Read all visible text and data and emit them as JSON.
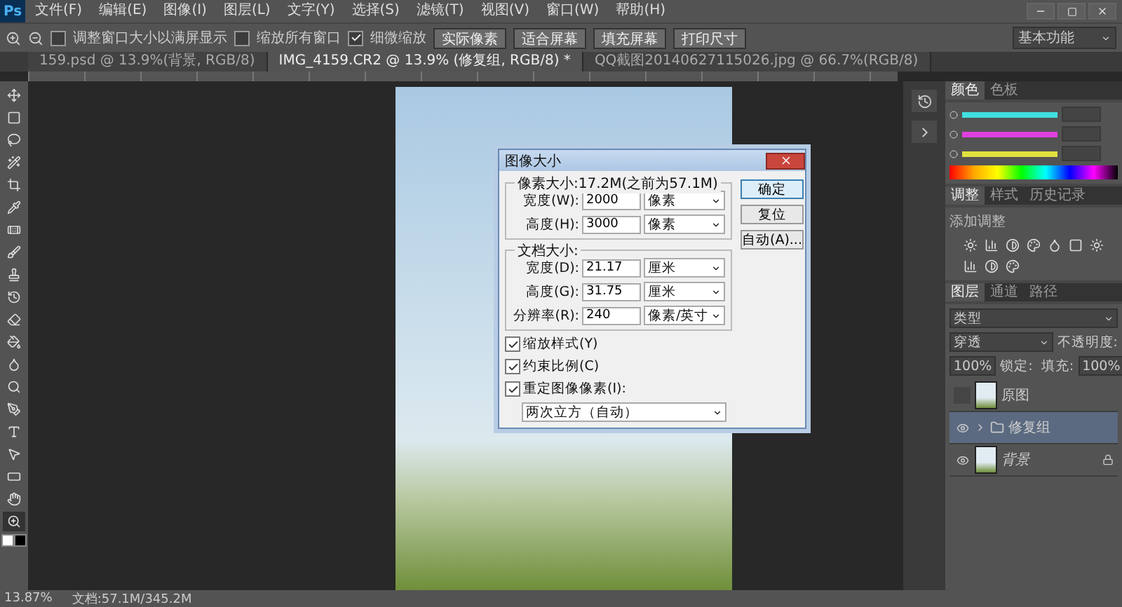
{
  "app_logo": "Ps",
  "menu": [
    "文件(F)",
    "编辑(E)",
    "图像(I)",
    "图层(L)",
    "文字(Y)",
    "选择(S)",
    "滤镜(T)",
    "视图(V)",
    "窗口(W)",
    "帮助(H)"
  ],
  "options": [
    {
      "kind": "check",
      "label": "调整窗口大小以满屏显示",
      "checked": false
    },
    {
      "kind": "check",
      "label": "缩放所有窗口",
      "checked": false
    },
    {
      "kind": "check",
      "label": "细微缩放",
      "checked": true
    },
    {
      "kind": "button",
      "label": "实际像素"
    },
    {
      "kind": "button",
      "label": "适合屏幕"
    },
    {
      "kind": "button",
      "label": "填充屏幕"
    },
    {
      "kind": "button",
      "label": "打印尺寸"
    }
  ],
  "workspace": "基本功能",
  "doc_tabs": [
    {
      "label": "159.psd @ 13.9%(背景, RGB/8)",
      "selected": false
    },
    {
      "label": "IMG_4159.CR2 @ 13.9% (修复组, RGB/8) *",
      "selected": true
    },
    {
      "label": "QQ截图20140627115026.jpg @ 66.7%(RGB/8)",
      "selected": false
    }
  ],
  "tools": [
    {
      "kind": "move",
      "selected": false
    },
    {
      "kind": "marquee",
      "selected": false
    },
    {
      "kind": "lasso",
      "selected": false
    },
    {
      "kind": "wand",
      "selected": false
    },
    {
      "kind": "crop",
      "selected": false
    },
    {
      "kind": "eyedropper",
      "selected": false
    },
    {
      "kind": "heal",
      "selected": false
    },
    {
      "kind": "brush",
      "selected": false
    },
    {
      "kind": "stamp",
      "selected": false
    },
    {
      "kind": "history",
      "selected": false
    },
    {
      "kind": "eraser",
      "selected": false
    },
    {
      "kind": "bucket",
      "selected": false
    },
    {
      "kind": "blur",
      "selected": false
    },
    {
      "kind": "dodge",
      "selected": false
    },
    {
      "kind": "pen",
      "selected": false
    },
    {
      "kind": "type",
      "selected": false
    },
    {
      "kind": "select",
      "selected": false
    },
    {
      "kind": "shape",
      "selected": false
    },
    {
      "kind": "hand",
      "selected": false
    },
    {
      "kind": "zoom",
      "selected": true
    }
  ],
  "dialog": {
    "title": "图像大小",
    "pixel_group": {
      "title": "像素大小:17.2M(之前为57.1M)",
      "rows": [
        {
          "label": "宽度(W):",
          "value": "2000",
          "unit": "像素"
        },
        {
          "label": "高度(H):",
          "value": "3000",
          "unit": "像素"
        }
      ]
    },
    "doc_group": {
      "title": "文档大小:",
      "rows": [
        {
          "label": "宽度(D):",
          "value": "21.17",
          "unit": "厘米"
        },
        {
          "label": "高度(G):",
          "value": "31.75",
          "unit": "厘米"
        },
        {
          "label": "分辨率(R):",
          "value": "240",
          "unit": "像素/英寸"
        }
      ]
    },
    "checks": [
      {
        "label": "缩放样式(Y)",
        "checked": true
      },
      {
        "label": "约束比例(C)",
        "checked": true
      },
      {
        "label": "重定图像像素(I):",
        "checked": true
      }
    ],
    "method": "两次立方（自动）",
    "buttons": [
      {
        "label": "确定",
        "default": true
      },
      {
        "label": "复位",
        "default": false
      },
      {
        "label": "自动(A)...",
        "default": false
      }
    ]
  },
  "color_panel": {
    "tabs": [
      {
        "label": "颜色",
        "selected": true
      },
      {
        "label": "色板",
        "selected": false
      }
    ],
    "sliders": [
      {
        "color": "#40e0e0",
        "level": 1
      },
      {
        "color": "#e040e0",
        "level": 1
      },
      {
        "color": "#e0e040",
        "level": 1
      }
    ]
  },
  "adjust_panel": {
    "tabs": [
      {
        "label": "调整",
        "selected": true
      },
      {
        "label": "样式",
        "selected": false
      },
      {
        "label": "历史记录",
        "selected": false
      }
    ],
    "subtitle": "添加调整"
  },
  "layers_panel": {
    "tabs": [
      {
        "label": "图层",
        "selected": true
      },
      {
        "label": "通道",
        "selected": false
      },
      {
        "label": "路径",
        "selected": false
      }
    ],
    "filter": "类型",
    "blend": "穿透",
    "opacity_label": "不透明度:",
    "opacity": "100%",
    "lock_label": "锁定:",
    "fill_label": "填充:",
    "fill": "100%",
    "layers": [
      {
        "kind": "image",
        "name": "原图",
        "visible": false,
        "selected": false,
        "locked": false
      },
      {
        "kind": "group",
        "name": "修复组",
        "visible": true,
        "selected": true,
        "locked": false
      },
      {
        "kind": "image",
        "name": "背景",
        "visible": true,
        "selected": false,
        "locked": true
      }
    ]
  },
  "status": {
    "zoom": "13.87%",
    "doc": "文档:57.1M/345.2M"
  }
}
